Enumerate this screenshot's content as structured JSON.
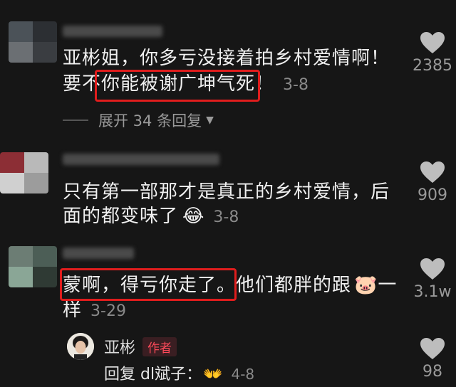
{
  "comments": [
    {
      "lines": [
        "亚彬姐，你多亏没接着拍乡村爱情啊！",
        "要不你能被谢广坤气死！"
      ],
      "date": "3-8",
      "likes": "2385",
      "expand_label": "展开 34 条回复"
    },
    {
      "lines": [
        "只有第一部那才是真正的乡村爱情，后",
        "面的都变味了"
      ],
      "emoji": "😂",
      "date": "3-8",
      "likes": "909"
    },
    {
      "lines": [
        "蒙啊，得亏你走了。他们都胖的跟",
        "样"
      ],
      "emoji": "🐷",
      "after_emoji": "一",
      "date": "3-29",
      "likes": "3.1w"
    }
  ],
  "reply": {
    "name": "亚彬",
    "badge": "作者",
    "text": "回复 dl斌子：",
    "emoji": "👐",
    "date": "4-8",
    "likes": "98"
  },
  "colors": {
    "highlight": "#e01d1d",
    "badge_text": "#ff4a5a",
    "background": "#161616"
  }
}
